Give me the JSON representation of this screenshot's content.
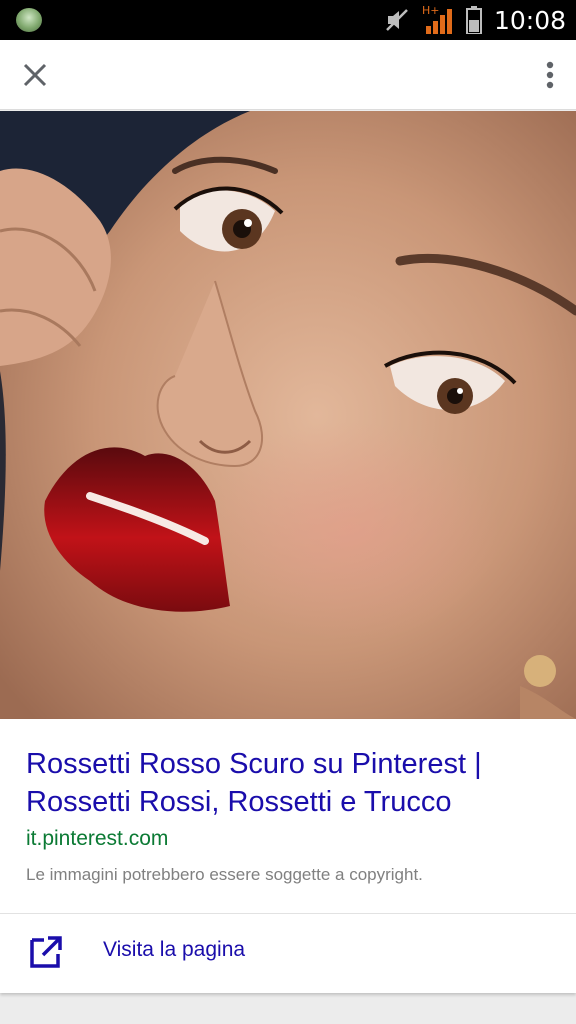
{
  "status_bar": {
    "time": "10:08",
    "network": "H+",
    "icons": [
      "app-icon",
      "mute-icon",
      "signal-icon",
      "battery-icon"
    ]
  },
  "toolbar": {
    "close_icon": "close-icon",
    "menu_icon": "more-vert-icon"
  },
  "image": {
    "subject": "close-up portrait with dark red lipstick"
  },
  "result": {
    "title": "Rossetti Rosso Scuro su Pinterest | Rossetti Rossi, Rossetti e Trucco",
    "url": "it.pinterest.com",
    "copyright_note": "Le immagini potrebbero essere soggette a copyright.",
    "visit_label": "Visita la pagina",
    "visit_icon": "open-in-new-icon"
  },
  "colors": {
    "title": "#1a0dab",
    "url": "#0b7a34",
    "network_signal": "#e06b1a"
  }
}
